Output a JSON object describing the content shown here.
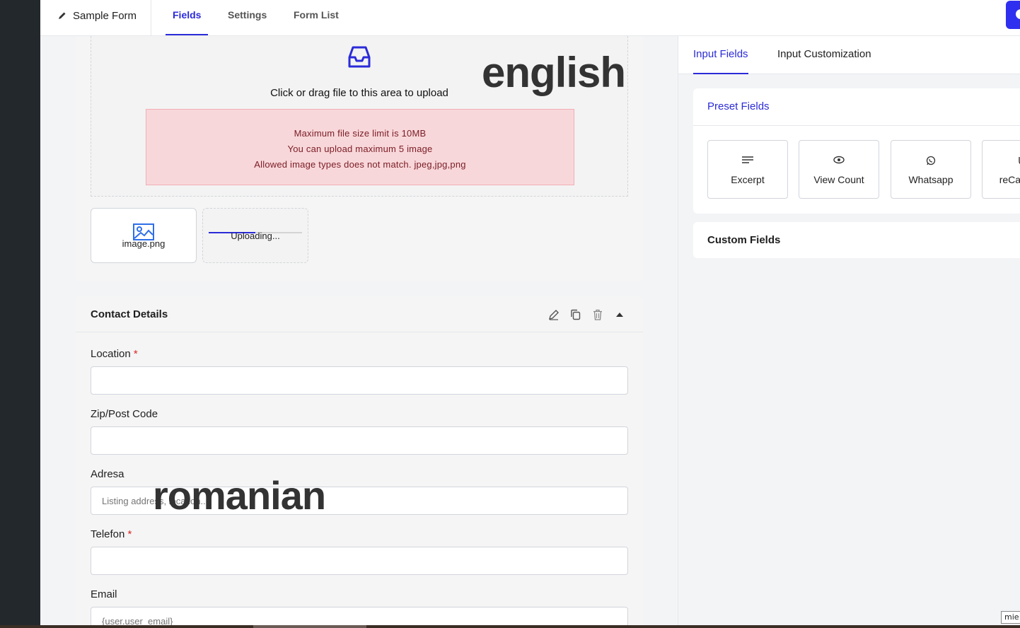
{
  "header": {
    "form_title": "Sample Form",
    "tabs": [
      {
        "label": "Fields",
        "active": true
      },
      {
        "label": "Settings",
        "active": false
      },
      {
        "label": "Form List",
        "active": false
      }
    ],
    "accent_color": "#2b2bd9"
  },
  "upload": {
    "dropzone_text": "Click or drag file to this area to upload",
    "errors": [
      "Maximum file size limit is 10MB",
      "You can upload maximum 5 image",
      "Allowed image types does not match. jpeg,jpg,png"
    ],
    "watermark": "english",
    "files": [
      {
        "name": "image.png",
        "icon": "image-icon"
      },
      {
        "status": "Uploading...",
        "progress": 0.5
      }
    ]
  },
  "contact": {
    "title": "Contact Details",
    "actions": [
      "edit-icon",
      "copy-icon",
      "trash-icon",
      "caret-up-icon"
    ],
    "watermark": "romanian",
    "fields": [
      {
        "label": "Location",
        "required": true,
        "placeholder": ""
      },
      {
        "label": "Zip/Post Code",
        "required": false,
        "placeholder": ""
      },
      {
        "label": "Adresa",
        "required": false,
        "placeholder": "Listing address, location..."
      },
      {
        "label": "Telefon",
        "required": true,
        "placeholder": ""
      },
      {
        "label": "Email",
        "required": false,
        "placeholder": "{user.user_email}"
      }
    ]
  },
  "right_panel": {
    "tabs": [
      {
        "label": "Input Fields",
        "active": true
      },
      {
        "label": "Input Customization",
        "active": false
      }
    ],
    "preset": {
      "title": "Preset Fields",
      "items": [
        {
          "label": "Excerpt",
          "icon": "excerpt-icon"
        },
        {
          "label": "View Count",
          "icon": "eye-icon"
        },
        {
          "label": "Whatsapp",
          "icon": "whatsapp-icon"
        },
        {
          "label": "reCaptcha",
          "icon": "recaptcha-icon"
        }
      ]
    },
    "custom": {
      "title": "Custom Fields"
    }
  },
  "corner_tag": "mie"
}
